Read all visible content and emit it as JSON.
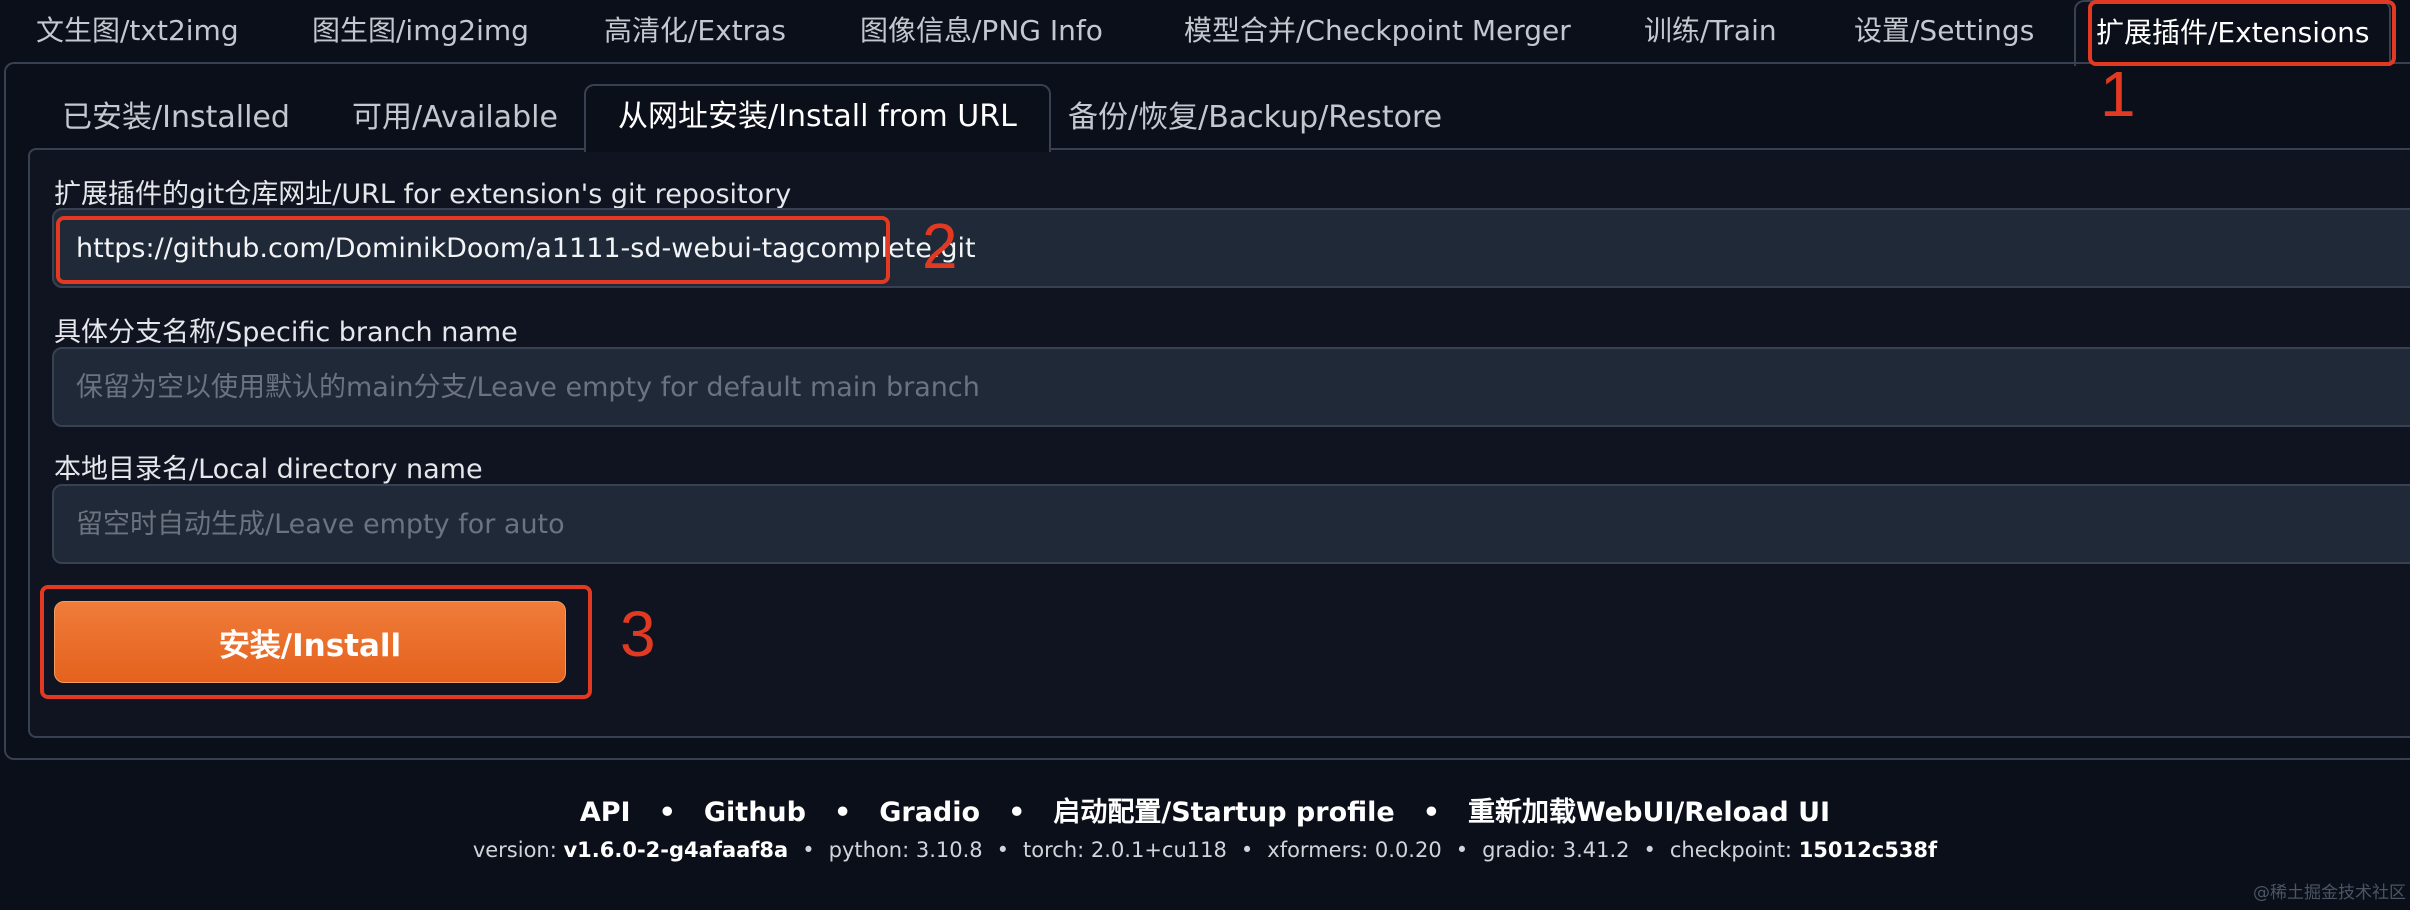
{
  "top_tabs": [
    {
      "label": "文生图/txt2img"
    },
    {
      "label": "图生图/img2img"
    },
    {
      "label": "高清化/Extras"
    },
    {
      "label": "图像信息/PNG Info"
    },
    {
      "label": "模型合并/Checkpoint Merger"
    },
    {
      "label": "训练/Train"
    },
    {
      "label": "设置/Settings"
    },
    {
      "label": "扩展插件/Extensions",
      "active": true
    }
  ],
  "sub_tabs": [
    {
      "label": "已安装/Installed"
    },
    {
      "label": "可用/Available"
    },
    {
      "label": "从网址安装/Install from URL",
      "active": true
    },
    {
      "label": "备份/恢复/Backup/Restore"
    }
  ],
  "form": {
    "url_label": "扩展插件的git仓库网址/URL for extension's git repository",
    "url_value": "https://github.com/DominikDoom/a1111-sd-webui-tagcomplete.git",
    "branch_label": "具体分支名称/Specific branch name",
    "branch_placeholder": "保留为空以使用默认的main分支/Leave empty for default main branch",
    "dir_label": "本地目录名/Local directory name",
    "dir_placeholder": "留空时自动生成/Leave empty for auto",
    "install_label": "安装/Install"
  },
  "annotations": [
    "1",
    "2",
    "3"
  ],
  "footer": {
    "links": [
      "API",
      "Github",
      "Gradio",
      "启动配置/Startup profile",
      "重新加载WebUI/Reload UI"
    ],
    "separator": "•",
    "versions": [
      {
        "key": "version: ",
        "value": "v1.6.0-2-g4afaaf8a",
        "bold": true
      },
      {
        "key": "python: ",
        "value": "3.10.8"
      },
      {
        "key": "torch: ",
        "value": "2.0.1+cu118"
      },
      {
        "key": "xformers: ",
        "value": "0.0.20"
      },
      {
        "key": "gradio: ",
        "value": "3.41.2"
      },
      {
        "key": "checkpoint: ",
        "value": "15012c538f",
        "bold": true
      }
    ]
  },
  "watermark": "@稀土掘金技术社区",
  "colors": {
    "background": "#0b0f19",
    "accent_orange": "#e96b2a",
    "annotation_red": "#e23a22",
    "input_bg": "#1f2937"
  }
}
